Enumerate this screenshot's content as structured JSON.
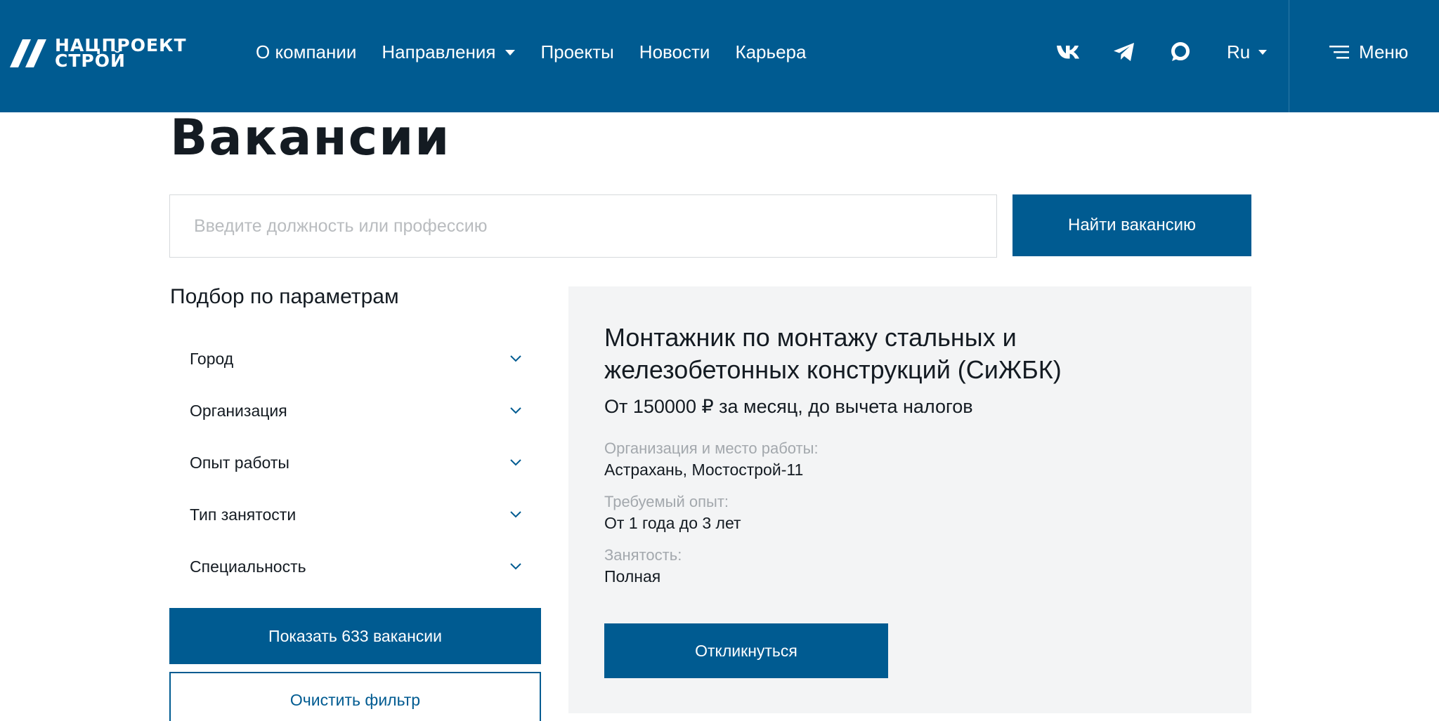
{
  "header": {
    "logo_line1": "НАЦПРОЕКТ",
    "logo_line2": "СТРОЙ",
    "nav": [
      {
        "label": "О компании",
        "has_dropdown": false
      },
      {
        "label": "Направления",
        "has_dropdown": true
      },
      {
        "label": "Проекты",
        "has_dropdown": false
      },
      {
        "label": "Новости",
        "has_dropdown": false
      },
      {
        "label": "Карьера",
        "has_dropdown": false
      }
    ],
    "social_icons": [
      "vk-icon",
      "telegram-icon",
      "max-messenger-icon"
    ],
    "lang": "Ru",
    "menu_label": "Меню"
  },
  "page_title": "Вакансии",
  "search": {
    "placeholder": "Введите должность или профессию",
    "value": "",
    "button_label": "Найти вакансию"
  },
  "filters": {
    "title": "Подбор по параметрам",
    "items": [
      {
        "label": "Город"
      },
      {
        "label": "Организация"
      },
      {
        "label": "Опыт работы"
      },
      {
        "label": "Тип занятости"
      },
      {
        "label": "Специальность"
      }
    ],
    "show_button": "Показать 633 вакансии",
    "clear_button": "Очистить фильтр"
  },
  "vacancy": {
    "title": "Монтажник по монтажу стальных и железобетонных конструкций (СиЖБК)",
    "salary": "От 150000 ₽ за месяц, до вычета налогов",
    "org_label": "Организация и место работы:",
    "org_value": "Астрахань, Мостострой-11",
    "exp_label": "Требуемый опыт:",
    "exp_value": "От 1 года до 3 лет",
    "employment_label": "Занятость:",
    "employment_value": "Полная",
    "respond_button": "Откликнуться"
  },
  "colors": {
    "brand": "#005b91",
    "card_bg": "#f3f4f5",
    "muted_text": "#a3a8ad"
  }
}
